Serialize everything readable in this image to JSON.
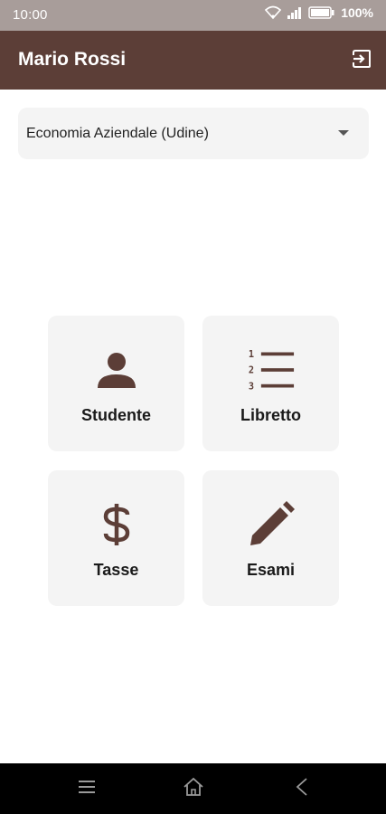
{
  "status_bar": {
    "time": "10:00",
    "battery": "100%"
  },
  "app_bar": {
    "title": "Mario Rossi",
    "logout_icon": "logout-icon"
  },
  "course_select": {
    "value": "Economia Aziendale (Udine)"
  },
  "tiles": [
    {
      "label": "Studente",
      "icon": "person-icon"
    },
    {
      "label": "Libretto",
      "icon": "numbered-list-icon"
    },
    {
      "label": "Tasse",
      "icon": "dollar-icon"
    },
    {
      "label": "Esami",
      "icon": "pencil-icon"
    }
  ],
  "nav_bar": {
    "menu_icon": "menu-icon",
    "home_icon": "home-icon",
    "back_icon": "back-icon"
  },
  "colors": {
    "primary": "#5c3e37",
    "status_bar": "#a89d9a",
    "tile_bg": "#f4f4f4",
    "icon": "#5c3e37"
  }
}
